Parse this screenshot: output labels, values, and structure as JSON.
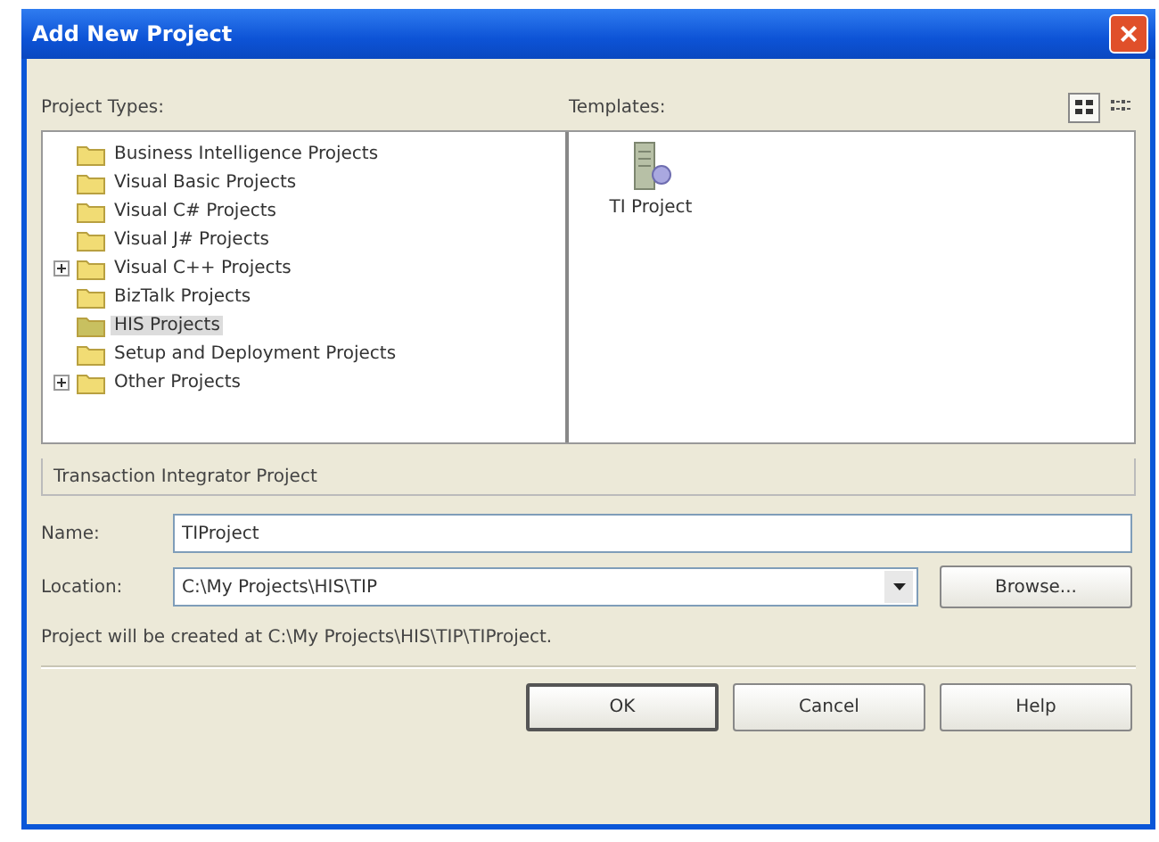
{
  "window": {
    "title": "Add New Project",
    "close": "×"
  },
  "project_types": {
    "label": "Project Types:",
    "items": [
      {
        "label": "Business Intelligence Projects",
        "expandable": false,
        "selected": false
      },
      {
        "label": "Visual Basic Projects",
        "expandable": false,
        "selected": false
      },
      {
        "label": "Visual C# Projects",
        "expandable": false,
        "selected": false
      },
      {
        "label": "Visual J# Projects",
        "expandable": false,
        "selected": false
      },
      {
        "label": "Visual C++ Projects",
        "expandable": true,
        "selected": false
      },
      {
        "label": "BizTalk Projects",
        "expandable": false,
        "selected": false
      },
      {
        "label": "HIS Projects",
        "expandable": false,
        "selected": true
      },
      {
        "label": "Setup and Deployment Projects",
        "expandable": false,
        "selected": false
      },
      {
        "label": "Other Projects",
        "expandable": true,
        "selected": false
      }
    ]
  },
  "templates": {
    "label": "Templates:",
    "views": [
      {
        "selected": true
      },
      {
        "selected": false
      }
    ],
    "items": [
      {
        "label": "TI Project",
        "selected": false
      }
    ]
  },
  "description": "Transaction Integrator Project",
  "name": {
    "label": "Name:",
    "value": "TIProject"
  },
  "location": {
    "label": "Location:",
    "value": "C:\\My Projects\\HIS\\TIP",
    "browse": "Browse..."
  },
  "message": "Project will be created at C:\\My Projects\\HIS\\TIP\\TIProject.",
  "buttons": [
    "OK",
    "Cancel",
    "Help"
  ]
}
